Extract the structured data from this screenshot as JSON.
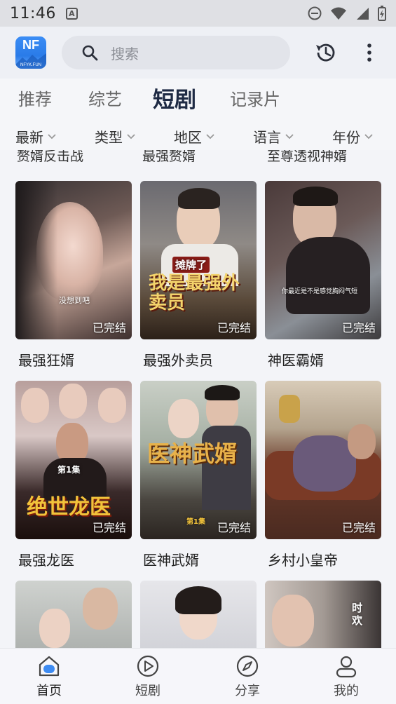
{
  "status_bar": {
    "time": "11:46",
    "notification_icon": "A"
  },
  "header": {
    "logo_text": "NF",
    "logo_subtext": "NFYK.FUN",
    "search_placeholder": "搜索"
  },
  "category_tabs": [
    {
      "label": "推荐",
      "active": false
    },
    {
      "label": "综艺",
      "active": false
    },
    {
      "label": "短剧",
      "active": true
    },
    {
      "label": "记录片",
      "active": false
    }
  ],
  "filters": [
    {
      "label": "最新"
    },
    {
      "label": "类型"
    },
    {
      "label": "地区"
    },
    {
      "label": "语言"
    },
    {
      "label": "年份"
    }
  ],
  "partial_titles": [
    "赘婿反击战",
    "最强赘婿",
    "至尊透视神婿"
  ],
  "cards": [
    {
      "title": "最强狂婿",
      "status": "已完结",
      "overlay": "没想到吧"
    },
    {
      "title": "最强外卖员",
      "status": "已完结",
      "overlay": "我是最强外卖员",
      "overlay_top": "摊牌了"
    },
    {
      "title": "神医霸婿",
      "status": "已完结",
      "overlay": "你最近是不是感觉胸闷气短"
    },
    {
      "title": "最强龙医",
      "status": "已完结",
      "overlay": "绝世龙医",
      "episode": "第1集"
    },
    {
      "title": "医神武婿",
      "status": "已完结",
      "overlay": "医神武婿",
      "episode": "第1集"
    },
    {
      "title": "乡村小皇帝",
      "status": "已完结",
      "overlay": ""
    },
    {
      "title": "",
      "status": "",
      "overlay": ""
    },
    {
      "title": "",
      "status": "",
      "overlay": ""
    },
    {
      "title": "",
      "status": "",
      "overlay": "时欢"
    }
  ],
  "bottom_nav": [
    {
      "label": "首页",
      "icon": "home-icon",
      "active": true
    },
    {
      "label": "短剧",
      "icon": "play-icon",
      "active": false
    },
    {
      "label": "分享",
      "icon": "compass-icon",
      "active": false
    },
    {
      "label": "我的",
      "icon": "user-icon",
      "active": false
    }
  ]
}
